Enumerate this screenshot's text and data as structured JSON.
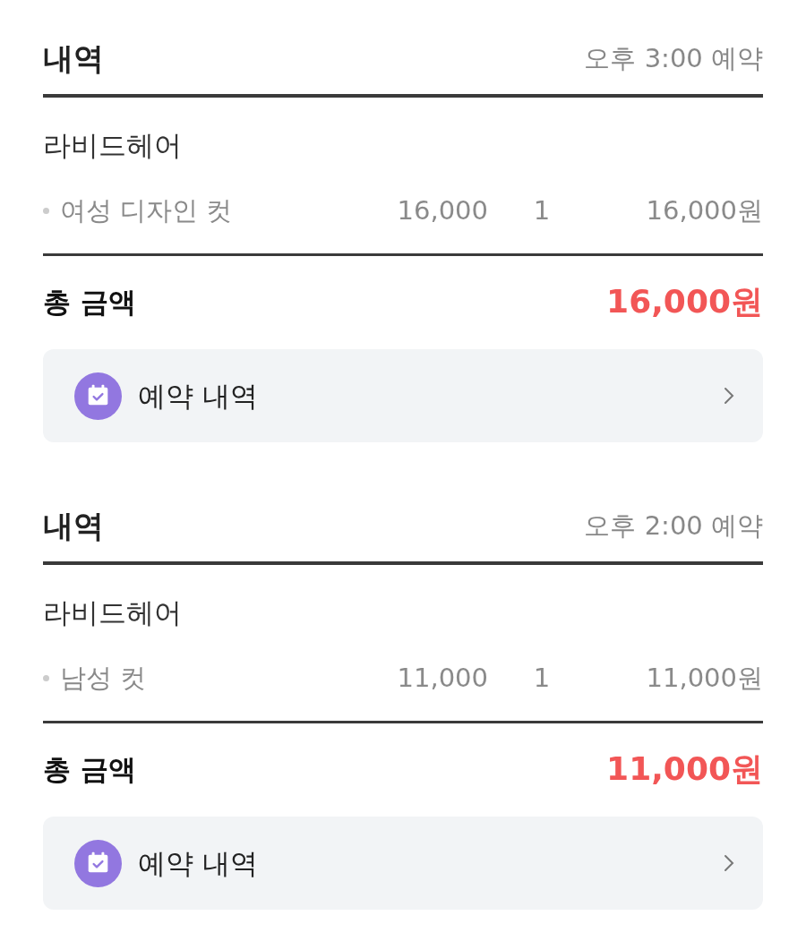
{
  "orders": [
    {
      "title": "내역",
      "time": "오후 3:00 예약",
      "shop": "라비드헤어",
      "items": [
        {
          "name": "여성 디자인 컷",
          "price": "16,000",
          "qty": "1",
          "amount": "16,000원"
        }
      ],
      "total_label": "총 금액",
      "total": "16,000원",
      "link_label": "예약 내역"
    },
    {
      "title": "내역",
      "time": "오후 2:00 예약",
      "shop": "라비드헤어",
      "items": [
        {
          "name": "남성 컷",
          "price": "11,000",
          "qty": "1",
          "amount": "11,000원"
        }
      ],
      "total_label": "총 금액",
      "total": "11,000원",
      "link_label": "예약 내역"
    }
  ]
}
